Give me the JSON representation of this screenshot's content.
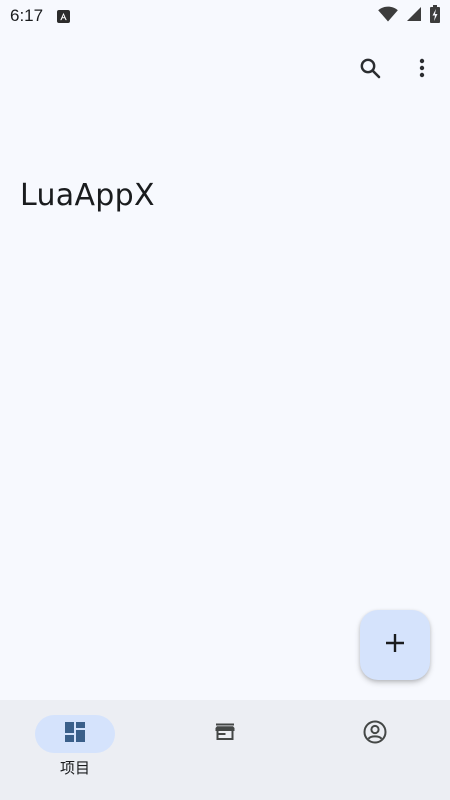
{
  "status_bar": {
    "time": "6:17",
    "notification_icon": "a-badge-icon",
    "icons": [
      "wifi-icon",
      "signal-icon",
      "battery-charging-icon"
    ]
  },
  "top_bar": {
    "actions": [
      "search-icon",
      "more-vert-icon"
    ]
  },
  "main": {
    "title": "LuaAppX"
  },
  "fab": {
    "icon": "add-icon"
  },
  "bottom_nav": {
    "items": [
      {
        "label": "项目",
        "icon": "dashboard-icon",
        "active": true
      },
      {
        "label": "",
        "icon": "store-icon",
        "active": false
      },
      {
        "label": "",
        "icon": "account-circle-icon",
        "active": false
      }
    ]
  },
  "colors": {
    "background": "#f7f9fe",
    "nav_background": "#eceef3",
    "accent_container": "#d5e3fc",
    "active_icon": "#3a5f8a",
    "icon": "#444746"
  }
}
